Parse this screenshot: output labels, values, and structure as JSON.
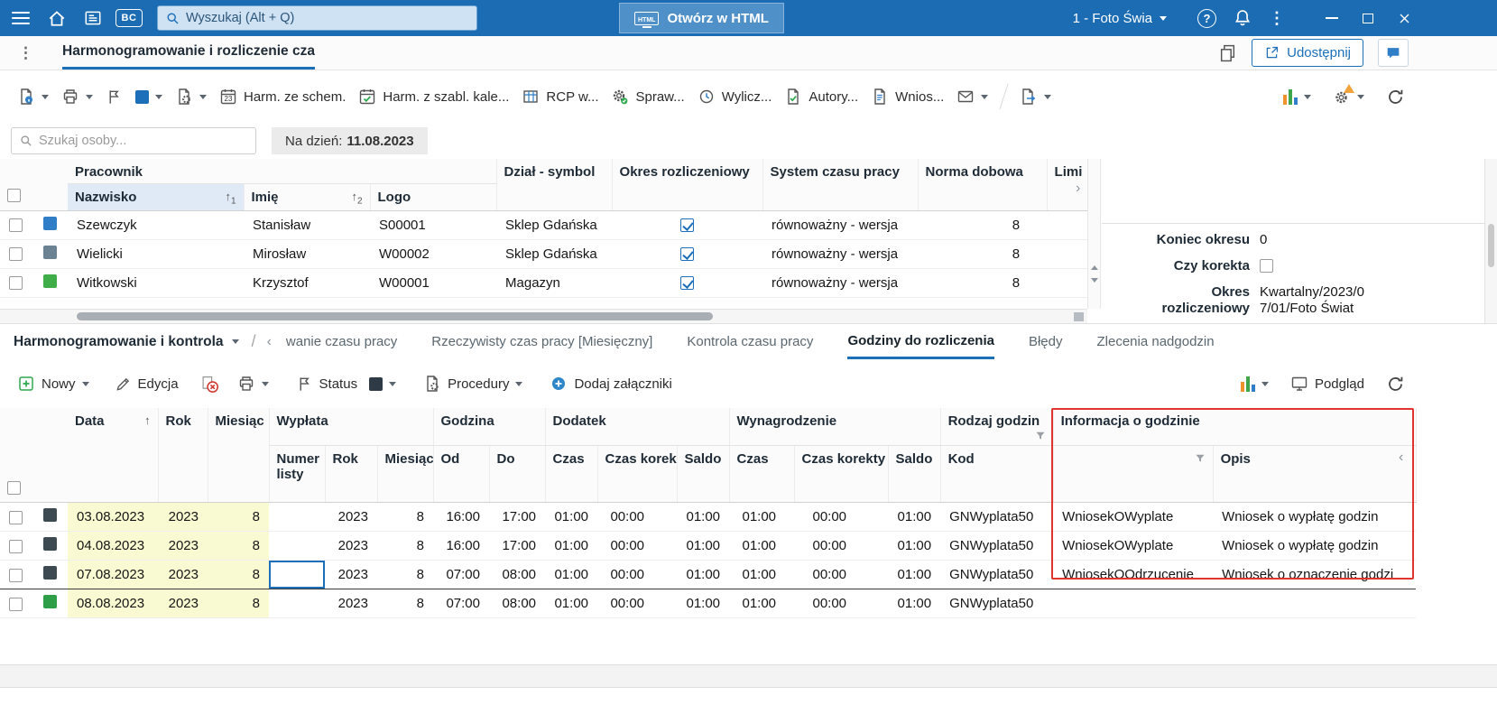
{
  "icons": {
    "sort_up": "↑",
    "chevron_right": "›",
    "chevron_left": "‹",
    "separator": "/",
    "help": "?",
    "kebab": "⋮"
  },
  "topbar": {
    "bc_badge": "BC",
    "search_placeholder": "Wyszukaj (Alt + Q)",
    "open_html_label": "Otwórz w HTML",
    "html_badge": "HTML",
    "company": "1 - Foto Świa"
  },
  "tabbar": {
    "title": "Harmonogramowanie i rozliczenie cza",
    "share_label": "Udostępnij"
  },
  "toolbar": {
    "calendar_day": "23",
    "harm_ze_schem": "Harm. ze schem.",
    "harm_z_szabl": "Harm. z szabl. kale...",
    "rcp": "RCP w...",
    "spraw": "Spraw...",
    "wylicz": "Wylicz...",
    "autory": "Autory...",
    "wnios": "Wnios..."
  },
  "filters": {
    "person_search_placeholder": "Szukaj osoby...",
    "date_label": "Na dzień:",
    "date_value": "11.08.2023"
  },
  "employees": {
    "group_pracownik": "Pracownik",
    "col_nazwisko": "Nazwisko",
    "col_imie": "Imię",
    "col_logo": "Logo",
    "col_dzial": "Dział - symbol",
    "col_okres": "Okres rozliczeniowy",
    "col_system": "System czasu pracy",
    "col_norma": "Norma dobowa",
    "col_limit": "Limi",
    "sort_rank_1": "1",
    "sort_rank_2": "2",
    "rows": [
      {
        "nazwisko": "Szewczyk",
        "imie": "Stanisław",
        "logo": "S00001",
        "dzial": "Sklep Gdańska",
        "system": "równoważny - wersja",
        "norma": "8"
      },
      {
        "nazwisko": "Wielicki",
        "imie": "Mirosław",
        "logo": "W00002",
        "dzial": "Sklep Gdańska",
        "system": "równoważny - wersja",
        "norma": "8"
      },
      {
        "nazwisko": "Witkowski",
        "imie": "Krzysztof",
        "logo": "W00001",
        "dzial": "Magazyn",
        "system": "równoważny - wersja",
        "norma": "8"
      }
    ]
  },
  "detail_panel": {
    "koniec_okresu_label": "Koniec okresu",
    "koniec_okresu_value": "0",
    "czy_korekta_label": "Czy korekta",
    "okres_label": "Okres rozliczeniowy",
    "okres_value": "Kwartalny/2023/07/01/Foto Świat"
  },
  "section_tabs": {
    "context": "Harmonogramowanie i kontrola",
    "tab_clipped": "wanie czasu pracy",
    "tab_rzeczywisty": "Rzeczywisty czas pracy [Miesięczny]",
    "tab_kontrola": "Kontrola czasu pracy",
    "tab_godziny": "Godziny do rozliczenia",
    "tab_bledy": "Błędy",
    "tab_zlecenia": "Zlecenia nadgodzin"
  },
  "hours_toolbar": {
    "nowy": "Nowy",
    "edycja": "Edycja",
    "status": "Status",
    "procedury": "Procedury",
    "dodaj_zalaczniki": "Dodaj załączniki",
    "podglad": "Podgląd"
  },
  "hours_grid": {
    "g_data": "Data",
    "g_rok": "Rok",
    "g_miesiac": "Miesiąc",
    "g_wyplata": "Wypłata",
    "g_godzina": "Godzina",
    "g_dodatek": "Dodatek",
    "g_wynagrodzenie": "Wynagrodzenie",
    "g_rodzaj": "Rodzaj godzin",
    "g_informacja": "Informacja o godzinie",
    "c_numer_listy": "Numer listy",
    "c_rok": "Rok",
    "c_miesiac": "Miesiąc",
    "c_od": "Od",
    "c_do": "Do",
    "c_czas": "Czas",
    "c_czas_korek": "Czas korek",
    "c_saldo": "Saldo",
    "c_czas2": "Czas",
    "c_czas_korekty": "Czas korekty",
    "c_saldo2": "Saldo",
    "c_kod": "Kod",
    "c_opis": "Opis",
    "rows": [
      {
        "data": "03.08.2023",
        "rok": "2023",
        "miesiac": "8",
        "numer_listy": "",
        "w_rok": "2023",
        "w_miesiac": "8",
        "od": "16:00",
        "do": "17:00",
        "d_czas": "01:00",
        "d_czas_korek": "00:00",
        "d_saldo": "01:00",
        "w_czas": "01:00",
        "w_czas_korekty": "00:00",
        "w_saldo": "01:00",
        "kod": "GNWyplata50",
        "info_kod": "WniosekOWyplate",
        "opis": "Wniosek o wypłatę godzin"
      },
      {
        "data": "04.08.2023",
        "rok": "2023",
        "miesiac": "8",
        "numer_listy": "",
        "w_rok": "2023",
        "w_miesiac": "8",
        "od": "16:00",
        "do": "17:00",
        "d_czas": "01:00",
        "d_czas_korek": "00:00",
        "d_saldo": "01:00",
        "w_czas": "01:00",
        "w_czas_korekty": "00:00",
        "w_saldo": "01:00",
        "kod": "GNWyplata50",
        "info_kod": "WniosekOWyplate",
        "opis": "Wniosek o wypłatę godzin"
      },
      {
        "data": "07.08.2023",
        "rok": "2023",
        "miesiac": "8",
        "numer_listy": "",
        "w_rok": "2023",
        "w_miesiac": "8",
        "od": "07:00",
        "do": "08:00",
        "d_czas": "01:00",
        "d_czas_korek": "00:00",
        "d_saldo": "01:00",
        "w_czas": "01:00",
        "w_czas_korekty": "00:00",
        "w_saldo": "01:00",
        "kod": "GNWyplata50",
        "info_kod": "WniosekOOdrzucenie",
        "opis": "Wniosek o oznaczenie godzi"
      },
      {
        "data": "08.08.2023",
        "rok": "2023",
        "miesiac": "8",
        "numer_listy": "",
        "w_rok": "2023",
        "w_miesiac": "8",
        "od": "07:00",
        "do": "08:00",
        "d_czas": "01:00",
        "d_czas_korek": "00:00",
        "d_saldo": "01:00",
        "w_czas": "01:00",
        "w_czas_korekty": "00:00",
        "w_saldo": "01:00",
        "kod": "GNWyplata50",
        "info_kod": "",
        "opis": ""
      }
    ]
  },
  "colors": {
    "accent": "#1d6fba",
    "topbar": "#1b6cb3",
    "annotation_red": "#e0352f",
    "status_dark": "#3d4a52",
    "status_green": "#2f9e49",
    "status_blue": "#2f7ec7",
    "status_slate": "#6b8292",
    "cell_yellow": "#fafad2"
  }
}
